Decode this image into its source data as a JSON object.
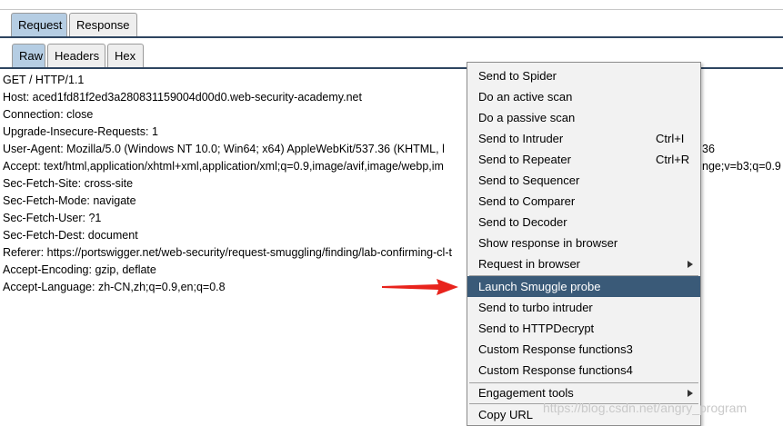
{
  "main_tabs": [
    {
      "label": "Request",
      "selected": true
    },
    {
      "label": "Response",
      "selected": false
    }
  ],
  "sub_tabs": [
    {
      "label": "Raw",
      "selected": true
    },
    {
      "label": "Headers",
      "selected": false
    },
    {
      "label": "Hex",
      "selected": false
    }
  ],
  "request_lines": [
    "GET / HTTP/1.1",
    "Host: aced1fd81f2ed3a280831159004d00d0.web-security-academy.net",
    "Connection: close",
    "Upgrade-Insecure-Requests: 1",
    "User-Agent: Mozilla/5.0 (Windows NT 10.0; Win64; x64) AppleWebKit/537.36 (KHTML, l",
    "Accept: text/html,application/xhtml+xml,application/xml;q=0.9,image/avif,image/webp,im",
    "Sec-Fetch-Site: cross-site",
    "Sec-Fetch-Mode: navigate",
    "Sec-Fetch-User: ?1",
    "Sec-Fetch-Dest: document",
    "Referer: https://portswigger.net/web-security/request-smuggling/finding/lab-confirming-cl-t",
    "Accept-Encoding: gzip, deflate",
    "Accept-Language: zh-CN,zh;q=0.9,en;q=0.8"
  ],
  "line_tails": {
    "user_agent_tail": "36",
    "accept_tail": "nge;v=b3;q=0.9"
  },
  "context_menu": {
    "items": [
      {
        "label": "Send to Spider"
      },
      {
        "label": "Do an active scan"
      },
      {
        "label": "Do a passive scan"
      },
      {
        "label": "Send to Intruder",
        "shortcut": "Ctrl+I"
      },
      {
        "label": "Send to Repeater",
        "shortcut": "Ctrl+R"
      },
      {
        "label": "Send to Sequencer"
      },
      {
        "label": "Send to Comparer"
      },
      {
        "label": "Send to Decoder"
      },
      {
        "label": "Show response in browser"
      },
      {
        "label": "Request in browser",
        "submenu": true
      },
      {
        "label": "Launch Smuggle probe",
        "highlighted": true
      },
      {
        "label": "Send to turbo intruder"
      },
      {
        "label": "Send to HTTPDecrypt"
      },
      {
        "label": "Custom Response functions3"
      },
      {
        "label": "Custom Response functions4"
      },
      {
        "label": "Engagement tools",
        "submenu": true
      },
      {
        "label": "Copy URL"
      }
    ]
  },
  "annotation": {
    "arrow_color": "#e8231c"
  },
  "colors": {
    "selected_tab": "#b5cde3",
    "menu_highlight": "#3a5a78",
    "tab_underline": "#2e4560"
  },
  "watermark": "https://blog.csdn.net/angry_program"
}
